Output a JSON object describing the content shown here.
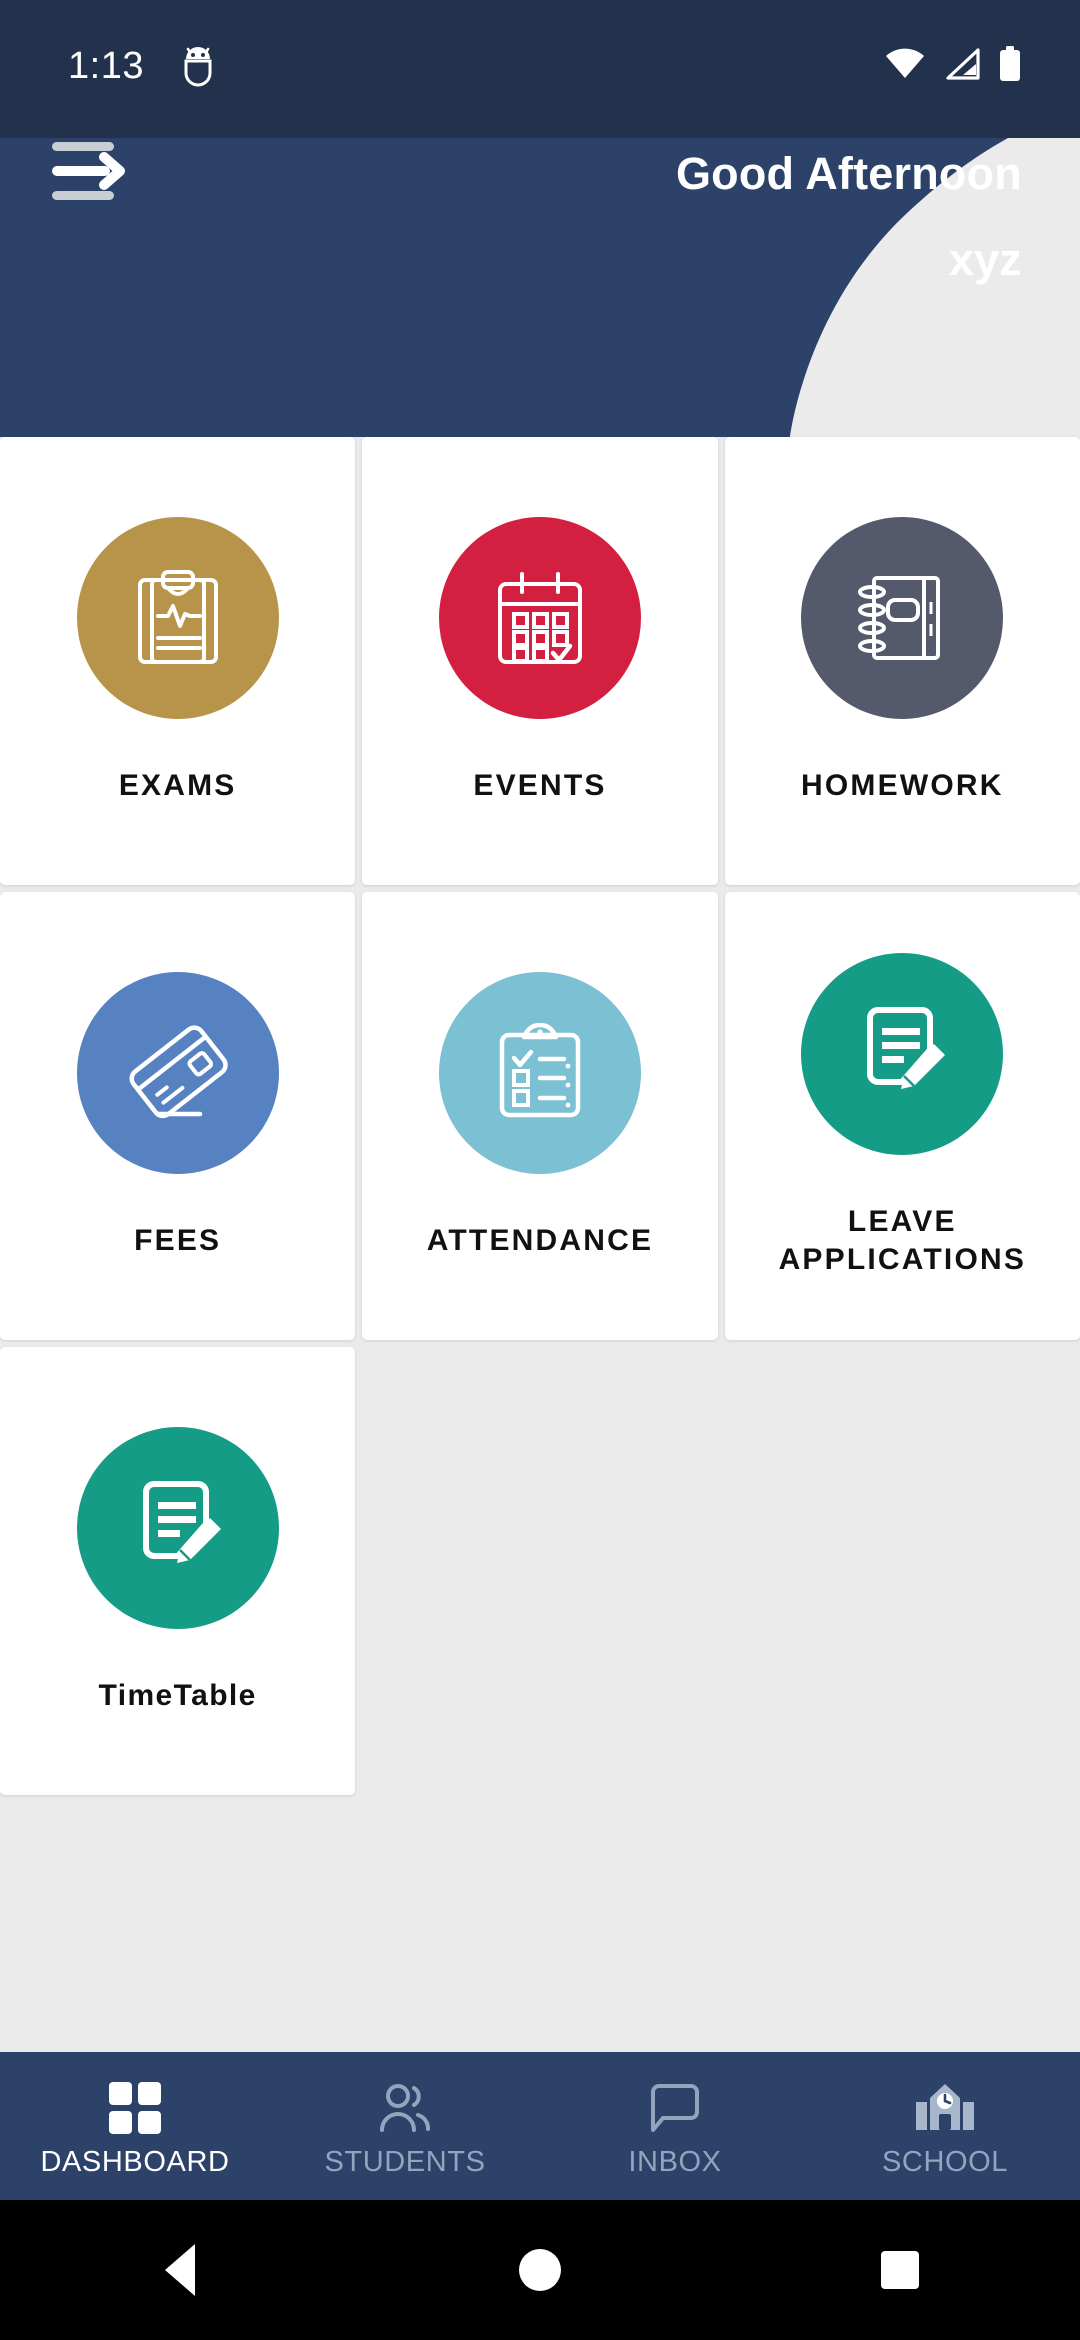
{
  "status_bar": {
    "time": "1:13",
    "icons": [
      "android-debug-icon",
      "wifi-icon",
      "cellular-signal-icon",
      "battery-icon"
    ]
  },
  "header": {
    "greeting": "Good Afternoon",
    "username": "xyz",
    "menu_icon": "hamburger-menu-arrow-icon",
    "background_color": "#2d4269",
    "statusbar_color": "#22314c"
  },
  "tiles": [
    {
      "label": "EXAMS",
      "icon": "exam-clipboard-icon",
      "color": "#b8944a"
    },
    {
      "label": "EVENTS",
      "icon": "calendar-check-icon",
      "color": "#d42040"
    },
    {
      "label": "HOMEWORK",
      "icon": "spiral-notebook-icon",
      "color": "#545a6b"
    },
    {
      "label": "FEES",
      "icon": "credit-card-icon",
      "color": "#5782c1"
    },
    {
      "label": "ATTENDANCE",
      "icon": "checklist-clipboard-icon",
      "color": "#7cc0d3"
    },
    {
      "label": "LEAVE\nAPPLICATIONS",
      "icon": "document-pencil-icon",
      "color": "#159c86"
    },
    {
      "label": "TimeTable",
      "icon": "document-pencil-icon",
      "color": "#159c86"
    }
  ],
  "bottom_nav": [
    {
      "label": "DASHBOARD",
      "icon": "grid-squares-icon",
      "active": true
    },
    {
      "label": "STUDENTS",
      "icon": "people-icon",
      "active": false
    },
    {
      "label": "INBOX",
      "icon": "chat-bubble-icon",
      "active": false
    },
    {
      "label": "SCHOOL",
      "icon": "school-clock-icon",
      "active": false
    }
  ],
  "system_nav": {
    "back": "back-triangle-icon",
    "home": "home-circle-icon",
    "recents": "recents-square-icon"
  }
}
